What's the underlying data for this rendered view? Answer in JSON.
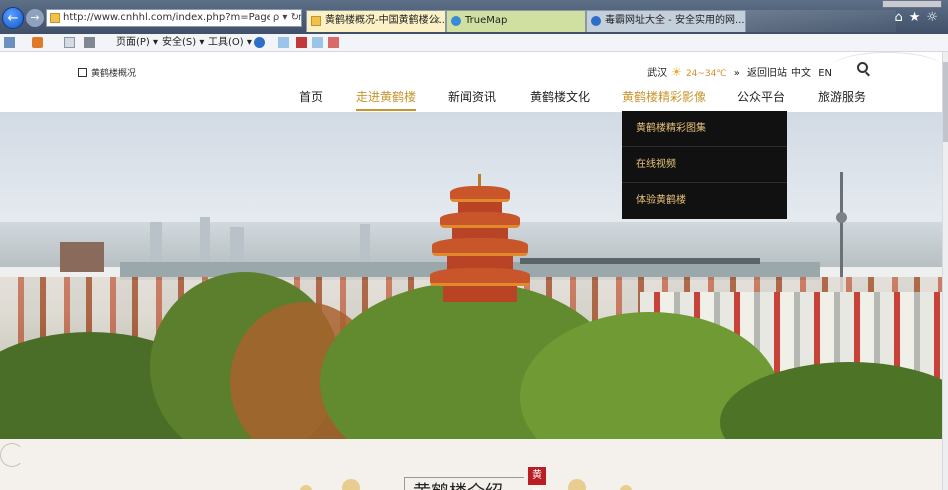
{
  "browser": {
    "url": "http://www.cnhhl.com/index.php?m=Page&a=ind",
    "url_host": "cnhhl.com",
    "address_controls": "ρ ▾ ↻",
    "tabs": [
      {
        "label": "黄鹤楼概况-中国黄鹤楼公...",
        "close": "×"
      },
      {
        "label": "TrueMap"
      },
      {
        "label": "毒霸网址大全 - 安全实用的网..."
      }
    ],
    "right_icons": "⌂★☼",
    "commands": [
      "页面(P) ▾",
      "安全(S) ▾",
      "工具(O) ▾"
    ]
  },
  "site": {
    "brand": "黄鹤楼概况",
    "city": "武汉",
    "weather_icon": "sun-cloud-icon",
    "temperature": "24~34℃",
    "chevrons": "»",
    "old_site_link": "返回旧站",
    "lang_cn": "中文",
    "lang_en": "EN",
    "nav": [
      "首页",
      "走进黄鹤楼",
      "新闻资讯",
      "黄鹤楼文化",
      "黄鹤楼精彩影像",
      "公众平台",
      "旅游服务"
    ],
    "active_nav": "走进黄鹤楼",
    "hover_nav": "黄鹤楼精彩影像",
    "dropdown": [
      "黄鹤楼精彩图集",
      "在线视频",
      "体验黄鹤楼"
    ]
  },
  "section": {
    "heading": "黄鹤楼介绍",
    "seal": "黄鹤"
  },
  "colors": {
    "accent_gold": "#c8942e",
    "dropdown_bg": "#111111",
    "dropdown_text": "#e9c37a",
    "seal_red": "#b81f24"
  }
}
